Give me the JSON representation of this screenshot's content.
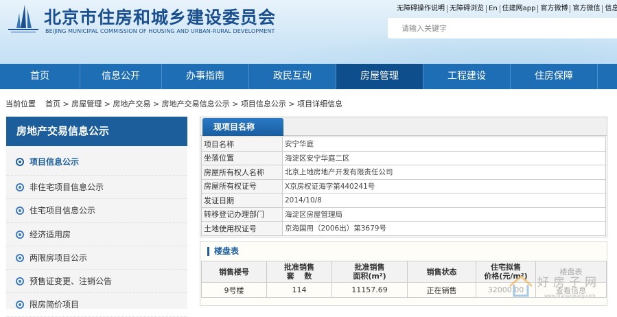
{
  "header": {
    "title": "北京市住房和城乡建设委员会",
    "subtitle": "BEIJING MUNICIPAL COMMISSION OF HOUSING AND URBAN-RURAL DEVELOPMENT",
    "top_links": [
      "无障碍操作说明",
      "无障碍浏览",
      "En",
      "住建网app",
      "官方微博",
      "官方微信",
      "信息订"
    ],
    "search_placeholder": "请输入关键字"
  },
  "nav": {
    "items": [
      "首页",
      "信息公开",
      "办事指南",
      "政民互动",
      "房屋管理",
      "工程建设",
      "住房保障"
    ],
    "active_index": 4
  },
  "breadcrumb": {
    "prefix": "当前位置",
    "items": [
      "首页",
      "房屋管理",
      "房地产交易",
      "房地产交易信息公示",
      "项目信息公示",
      "项目详细信息"
    ],
    "separator": ">"
  },
  "sidebar": {
    "title": "房地产交易信息公示",
    "items": [
      "项目信息公示",
      "非住宅项目信息公示",
      "住宅项目信息公示",
      "经济适用房",
      "两限房项目公示",
      "预售证变更、注销公告",
      "限房简价项目"
    ],
    "active_index": 0
  },
  "project": {
    "tab": "现项目名称",
    "rows": [
      {
        "label": "项目名称",
        "value": "安宁华庭"
      },
      {
        "label": "坐落位置",
        "value": "海淀区安宁华庭二区"
      },
      {
        "label": "房屋所有权人名称",
        "value": "北京上地房地产开发有限责任公司"
      },
      {
        "label": "房屋所有权证号",
        "value": "X京房权证海字第440241号"
      },
      {
        "label": "发证日期",
        "value": "2014/10/8"
      },
      {
        "label": "转移登记办理部门",
        "value": "海淀区房屋管理局"
      },
      {
        "label": "土地使用权证号",
        "value": "京海国用（2006出）第3679号"
      }
    ]
  },
  "building_table": {
    "title": "楼盘表",
    "headers": [
      {
        "line1": "销售楼号",
        "line2": ""
      },
      {
        "line1": "批准销售",
        "line2": "套　 数"
      },
      {
        "line1": "批准销售",
        "line2": "面积(m²)"
      },
      {
        "line1": "销售状态",
        "line2": ""
      },
      {
        "line1": "住宅拟售",
        "line2": "价格(元/m²)"
      },
      {
        "line1": "楼盘表",
        "line2": ""
      }
    ],
    "rows": [
      {
        "building": "9号楼",
        "units": "114",
        "area": "11157.69",
        "status": "正在销售",
        "price": "32000.00",
        "action": "查看信息"
      }
    ]
  },
  "watermark": {
    "text": "好房子网",
    "url": "www.hfangziwang.com"
  }
}
